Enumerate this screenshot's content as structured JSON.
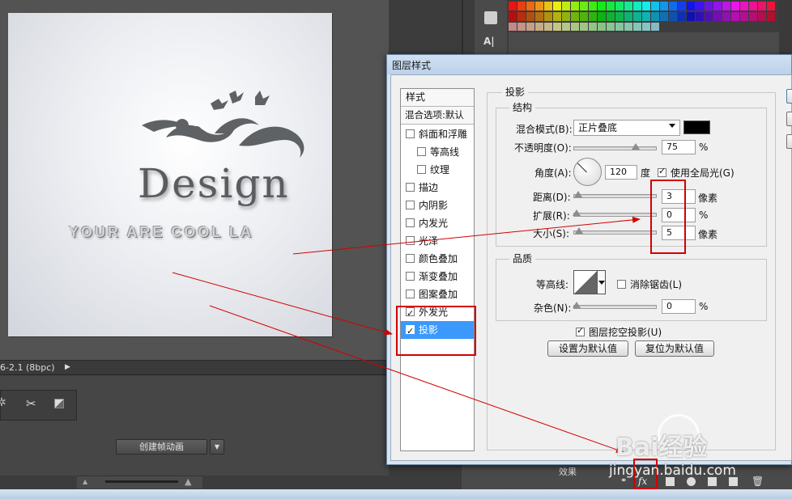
{
  "canvas": {
    "design_text": "Design",
    "slogan_text": "YOUR ARE COOL LA"
  },
  "statusbar": {
    "text": "6-2.1 (8bpc)"
  },
  "timeline": {
    "create_frame_label": "创建帧动画"
  },
  "dialog": {
    "title": "图层样式",
    "styles_header": "样式",
    "blend_options_label": "混合选项:默认",
    "style_items": [
      {
        "label": "斜面和浮雕",
        "checked": false,
        "sub": false
      },
      {
        "label": "等高线",
        "checked": false,
        "sub": true
      },
      {
        "label": "纹理",
        "checked": false,
        "sub": true
      },
      {
        "label": "描边",
        "checked": false,
        "sub": false
      },
      {
        "label": "内阴影",
        "checked": false,
        "sub": false
      },
      {
        "label": "内发光",
        "checked": false,
        "sub": false
      },
      {
        "label": "光泽",
        "checked": false,
        "sub": false
      },
      {
        "label": "颜色叠加",
        "checked": false,
        "sub": false
      },
      {
        "label": "渐变叠加",
        "checked": false,
        "sub": false
      },
      {
        "label": "图案叠加",
        "checked": false,
        "sub": false
      },
      {
        "label": "外发光",
        "checked": true,
        "sub": false
      },
      {
        "label": "投影",
        "checked": true,
        "sub": false,
        "selected": true
      }
    ],
    "section_title": "投影",
    "structure": {
      "title": "结构",
      "blend_mode_label": "混合模式(B):",
      "blend_mode_value": "正片叠底",
      "shadow_color": "#000000",
      "opacity_label": "不透明度(O):",
      "opacity_value": "75",
      "opacity_unit": "%",
      "opacity_fraction": 0.75,
      "angle_label": "角度(A):",
      "angle_value": "120",
      "angle_unit": "度",
      "global_light_label": "使用全局光(G)",
      "global_light_checked": true,
      "distance_label": "距离(D):",
      "distance_value": "3",
      "distance_unit": "像素",
      "spread_label": "扩展(R):",
      "spread_value": "0",
      "spread_unit": "%",
      "size_label": "大小(S):",
      "size_value": "5",
      "size_unit": "像素"
    },
    "quality": {
      "title": "品质",
      "contour_label": "等高线:",
      "antialias_label": "消除锯齿(L)",
      "antialias_checked": false,
      "noise_label": "杂色(N):",
      "noise_value": "0",
      "noise_unit": "%"
    },
    "knockout_label": "图层挖空投影(U)",
    "knockout_checked": true,
    "set_default_label": "设置为默认值",
    "reset_default_label": "复位为默认值"
  },
  "layers": {
    "effect_label": "效果",
    "fx_label": "fx"
  },
  "watermark": {
    "brand": "Bai经验",
    "url": "jingyan.baidu.com"
  },
  "annotation_color": "#d40000",
  "selection_color": "#3b99fc"
}
